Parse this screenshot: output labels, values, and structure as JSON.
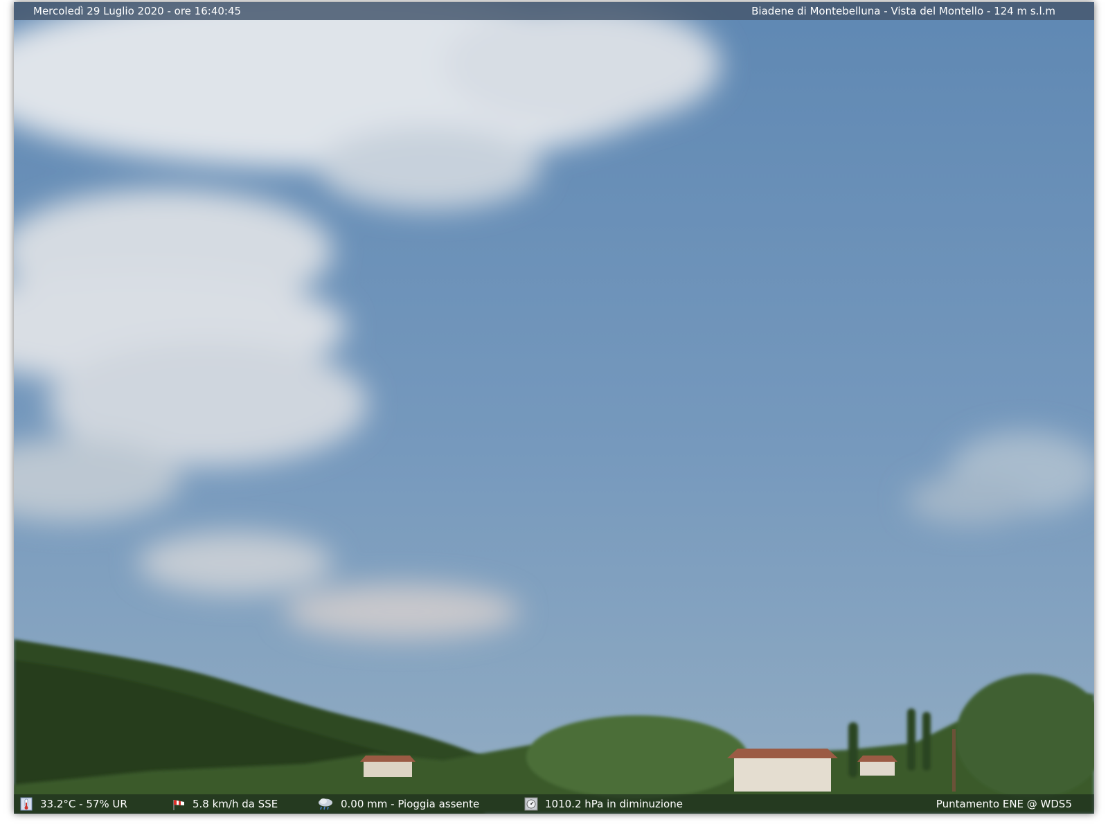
{
  "top_bar": {
    "datetime": "Mercoledì 29 Luglio 2020 - ore 16:40:45",
    "location": "Biadene di Montebelluna - Vista del Montello - 124 m s.l.m"
  },
  "bottom_bar": {
    "temperature_humidity": "33.2°C - 57% UR",
    "wind": "5.8 km/h da SSE",
    "rain": "0.00 mm - Pioggia assente",
    "pressure": "1010.2 hPa in diminuzione",
    "camera_info": "Puntamento ENE  @ WDS5"
  },
  "icons": {
    "temperature": "thermometer-icon",
    "wind": "windsock-icon",
    "rain": "rain-cloud-icon",
    "pressure": "barometer-icon"
  },
  "colors": {
    "sky_top": "#5f88b3",
    "sky_bottom": "#8aa6bf",
    "clouds": "#dde3ea",
    "vegetation": "#2f4a22"
  }
}
